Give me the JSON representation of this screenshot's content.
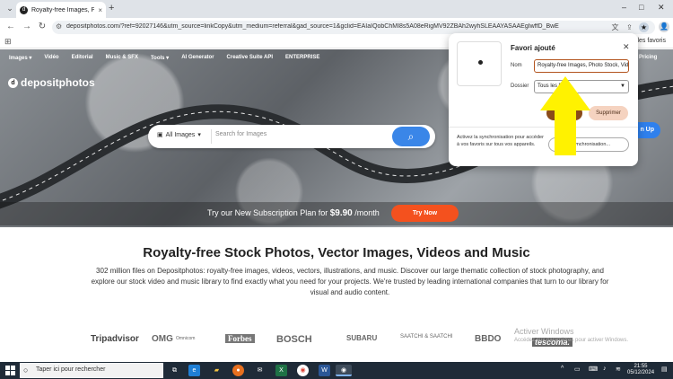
{
  "browser": {
    "tab_title": "Royalty-free Images, Photo Sto...",
    "tab_close": "×",
    "new_tab": "+",
    "url": "depositphotos.com/?ref=92027146&utm_source=linkCopy&utm_medium=referral&gad_source=1&gclid=EAIaIQobChMI8s5A08eRigMV92ZBAh2wyhSLEAAYASAAEgIwffD_BwE",
    "all_bookmarks": "Tous les favoris",
    "minimize": "–",
    "maximize": "□",
    "close": "✕",
    "back": "←",
    "forward": "→",
    "reload": "↻",
    "profile": "👤"
  },
  "site": {
    "nav": [
      "Images ▾",
      "Vidéo",
      "Editorial",
      "Music & SFX",
      "Tools ▾",
      "AI Generator",
      "Creative Suite API",
      "ENTERPRISE"
    ],
    "pricing": "Pricing",
    "logo": "depositphotos",
    "signup": "n Up",
    "search": {
      "category": "All Images",
      "placeholder": "Search for Images"
    },
    "promo": {
      "prefix": "Try our New Subscription Plan for ",
      "price": "$9.90",
      "suffix": " /month",
      "button": "Try Now"
    },
    "headline": "Royalty-free Stock Photos, Vector Images, Videos and Music",
    "description": "302 million files on Depositphotos: royalty-free images, videos, vectors, illustrations, and music. Discover our large thematic collection of stock photography, and explore our stock video and music library to find exactly what you need for your projects. We're trusted by leading international companies that turn to our library for visual and audio content.",
    "brands": [
      "Tripadvisor",
      "OMG",
      "Omnicom",
      "Forbes",
      "BOSCH",
      "SUBARU",
      "SAATCHI & SAATCHI",
      "BBDO",
      "tescoma."
    ]
  },
  "bookmark_popup": {
    "title": "Favori ajouté",
    "name_label": "Nom",
    "name_value": "Royalty-free Images, Photo Stock, Vide",
    "folder_label": "Dossier",
    "folder_value": "Tous les f",
    "modify_button": "",
    "delete_button": "Supprimer",
    "sync_message": "Activez la synchronisation pour accéder à vos favoris sur tous vos appareils.",
    "sync_button": "Ac         ynchronisation..."
  },
  "windows": {
    "activate_title": "Activer Windows",
    "activate_sub": "Accédez aux paramètres pour activer Windows.",
    "search_placeholder": "Taper ici pour rechercher",
    "time": "21:55",
    "date": "05/12/2024",
    "word_icon": "W",
    "excel_icon": "X"
  },
  "colors": {
    "accent_blue": "#3a86e8",
    "promo_orange": "#f4511e",
    "popup_brown": "#8a4b1a",
    "annotation_yellow": "#fff200"
  }
}
